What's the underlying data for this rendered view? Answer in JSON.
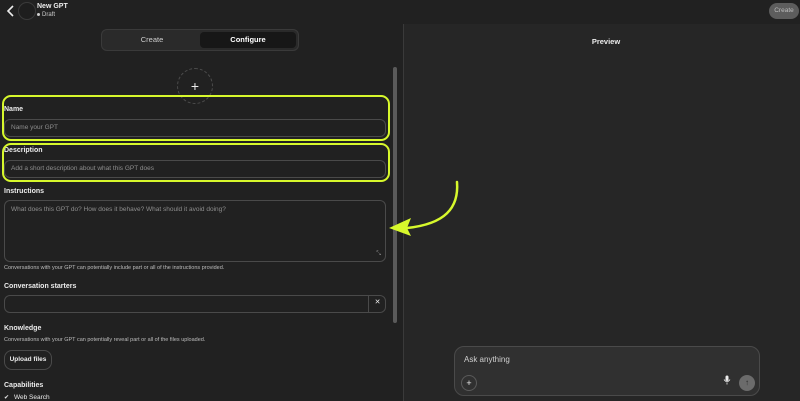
{
  "header": {
    "back_icon": "chevron-left-icon",
    "gpt_name": "New GPT",
    "status": "Draft",
    "create_label": "Create"
  },
  "tabs": [
    {
      "label": "Create",
      "active": false
    },
    {
      "label": "Configure",
      "active": true
    }
  ],
  "form": {
    "add_image_icon": "plus-icon",
    "name": {
      "label": "Name",
      "placeholder": "Name your GPT"
    },
    "description": {
      "label": "Description",
      "placeholder": "Add a short description about what this GPT does"
    },
    "instructions": {
      "label": "Instructions",
      "placeholder": "What does this GPT do? How does it behave? What should it avoid doing?",
      "hint": "Conversations with your GPT can potentially include part or all of the instructions provided."
    },
    "starters": {
      "label": "Conversation starters",
      "remove_icon": "close-icon"
    },
    "knowledge": {
      "label": "Knowledge",
      "hint": "Conversations with your GPT can potentially reveal part or all of the files uploaded.",
      "upload_label": "Upload files"
    },
    "capabilities": {
      "label": "Capabilities",
      "items": [
        {
          "label": "Web Search",
          "checked": true
        }
      ]
    }
  },
  "preview": {
    "title": "Preview",
    "composer_placeholder": "Ask anything",
    "plus_icon": "plus-icon",
    "mic_icon": "mic-icon",
    "send_icon": "arrow-up-icon"
  },
  "colors": {
    "highlight": "#d7f82c",
    "background": "#212121",
    "preview_background": "#262626"
  }
}
